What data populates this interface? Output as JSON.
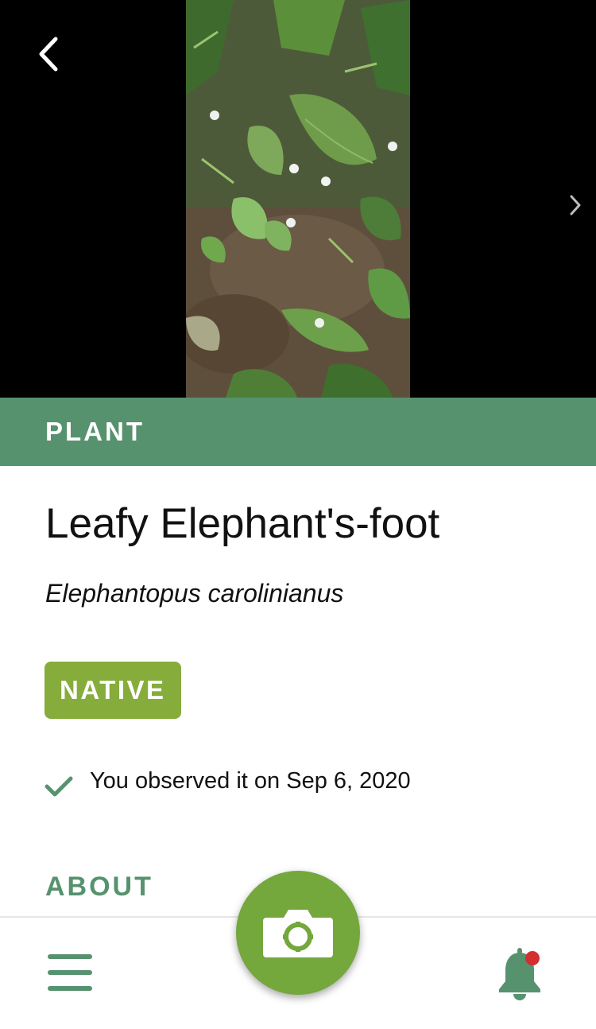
{
  "photo": {
    "back_icon": "chevron-left-icon",
    "next_icon": "chevron-right-icon"
  },
  "species": {
    "category": "PLANT",
    "common_name": "Leafy Elephant's-foot",
    "scientific_name": "Elephantopus carolinianus",
    "status_badge": "NATIVE",
    "observed_text": "You observed it on Sep 6, 2020"
  },
  "sections": {
    "about_heading": "ABOUT"
  },
  "bottom_nav": {
    "menu_icon": "hamburger-menu-icon",
    "camera_icon": "camera-icon",
    "notifications_icon": "bell-icon",
    "has_unread_notifications": true
  },
  "colors": {
    "brand_green": "#56926e",
    "native_green": "#86ad3c",
    "camera_green": "#74a73c",
    "notification_dot": "#d32f2f"
  }
}
